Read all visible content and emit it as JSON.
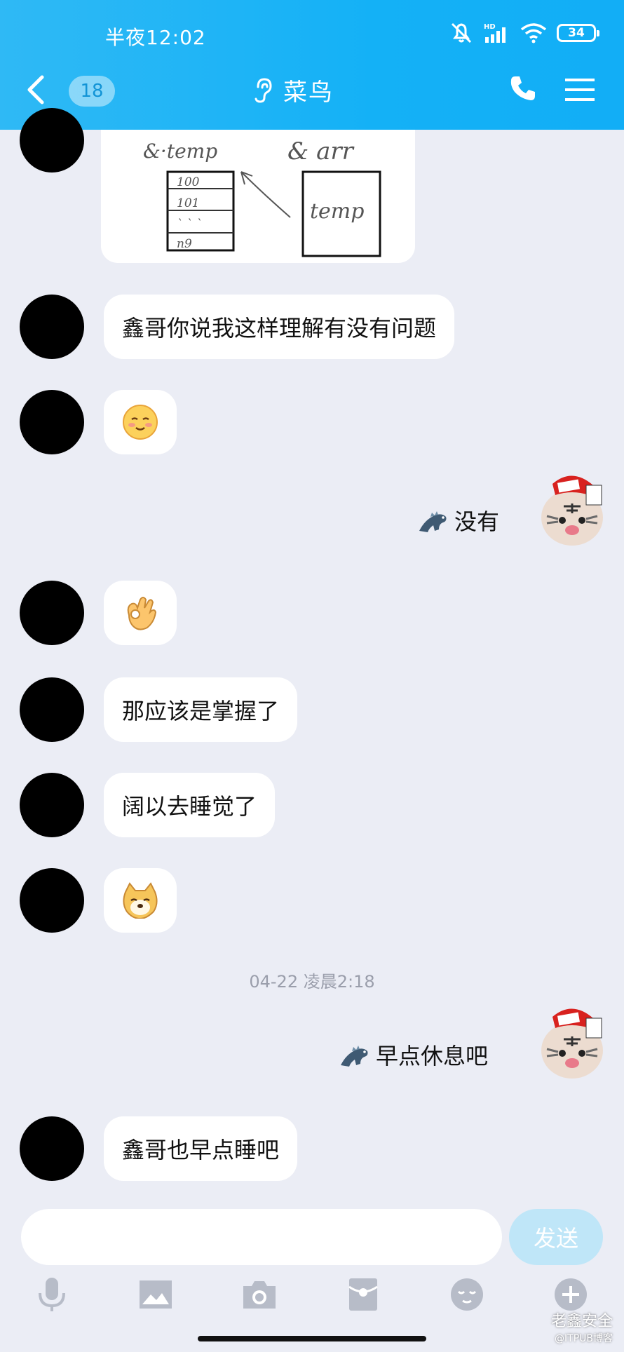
{
  "status_bar": {
    "time": "半夜12:02",
    "battery": "34",
    "network": "HD"
  },
  "header": {
    "unread_count": "18",
    "title": "菜鸟"
  },
  "drawing": {
    "left_label": "&·temp",
    "right_label": "& arr",
    "rows": [
      "100",
      "101",
      "` ` `",
      "n9"
    ],
    "box_text": "temp"
  },
  "messages": [
    {
      "side": "left",
      "type": "text",
      "text": "鑫哥你说我这样理解有没有问题"
    },
    {
      "side": "left",
      "type": "emoji",
      "emoji": "shy-smile"
    },
    {
      "side": "right",
      "type": "text",
      "text": "没有"
    },
    {
      "side": "left",
      "type": "emoji",
      "emoji": "ok-hand"
    },
    {
      "side": "left",
      "type": "text",
      "text": "那应该是掌握了"
    },
    {
      "side": "left",
      "type": "text",
      "text": "阔以去睡觉了"
    },
    {
      "side": "left",
      "type": "emoji",
      "emoji": "dog-face"
    },
    {
      "side": "right",
      "type": "text",
      "text": "早点休息吧"
    },
    {
      "side": "left",
      "type": "text",
      "text": "鑫哥也早点睡吧"
    }
  ],
  "timestamp": "04-22 凌晨2:18",
  "input": {
    "placeholder": "",
    "value": "",
    "send_label": "发送"
  },
  "toolbar_icons": [
    "microphone-icon",
    "image-icon",
    "camera-icon",
    "red-packet-icon",
    "emoji-icon",
    "plus-icon"
  ],
  "watermark": {
    "line1": "老鑫安全",
    "line2": "@ITPUB博客"
  },
  "colors": {
    "header": "#14b1f6",
    "background": "#ebedf5",
    "send_button": "#bfe6f8"
  }
}
